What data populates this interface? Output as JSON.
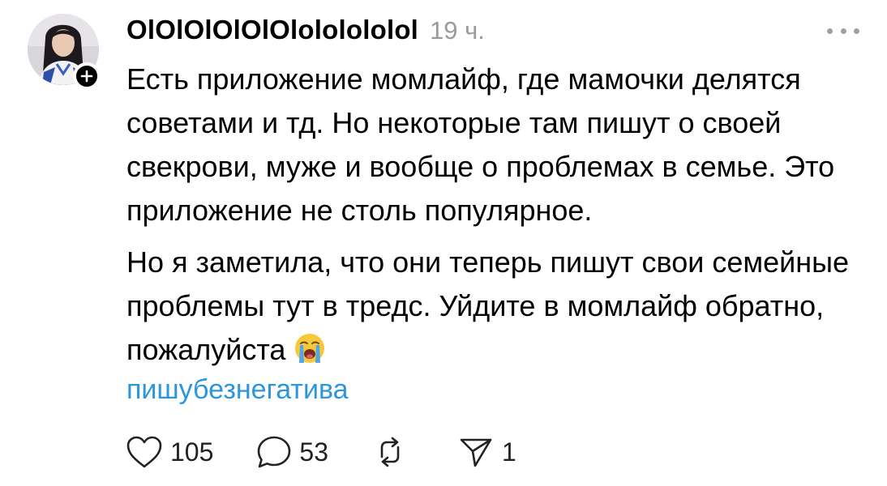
{
  "post": {
    "username": "OlOlOlOlOlOlololololol",
    "timestamp": "19 ч.",
    "paragraphs": [
      "Есть приложение момлайф, где мамочки делятся советами и тд. Но некоторые там пишут о своей свекрови, муже и вообще о проблемах в семье. Это приложение не столь популярное.",
      "Но я заметила, что они теперь пишут свои семейные проблемы тут в тредс. Уйдите в момлайф обратно, пожалуйста"
    ],
    "emoji": "loudly-crying-face",
    "hashtag": "пишубезнегатива"
  },
  "actions": {
    "likes": "105",
    "replies": "53",
    "reposts": "",
    "shares": "1"
  },
  "icons": {
    "avatar": "profile-photo",
    "follow": "plus-icon",
    "more": "more-horizontal-icon",
    "like": "heart-icon",
    "reply": "comment-bubble-icon",
    "repost": "repost-arrows-icon",
    "share": "send-paper-plane-icon"
  },
  "colors": {
    "hashtag": "#2c96dc",
    "timestamp": "#9a9a9a",
    "text": "#000000"
  }
}
